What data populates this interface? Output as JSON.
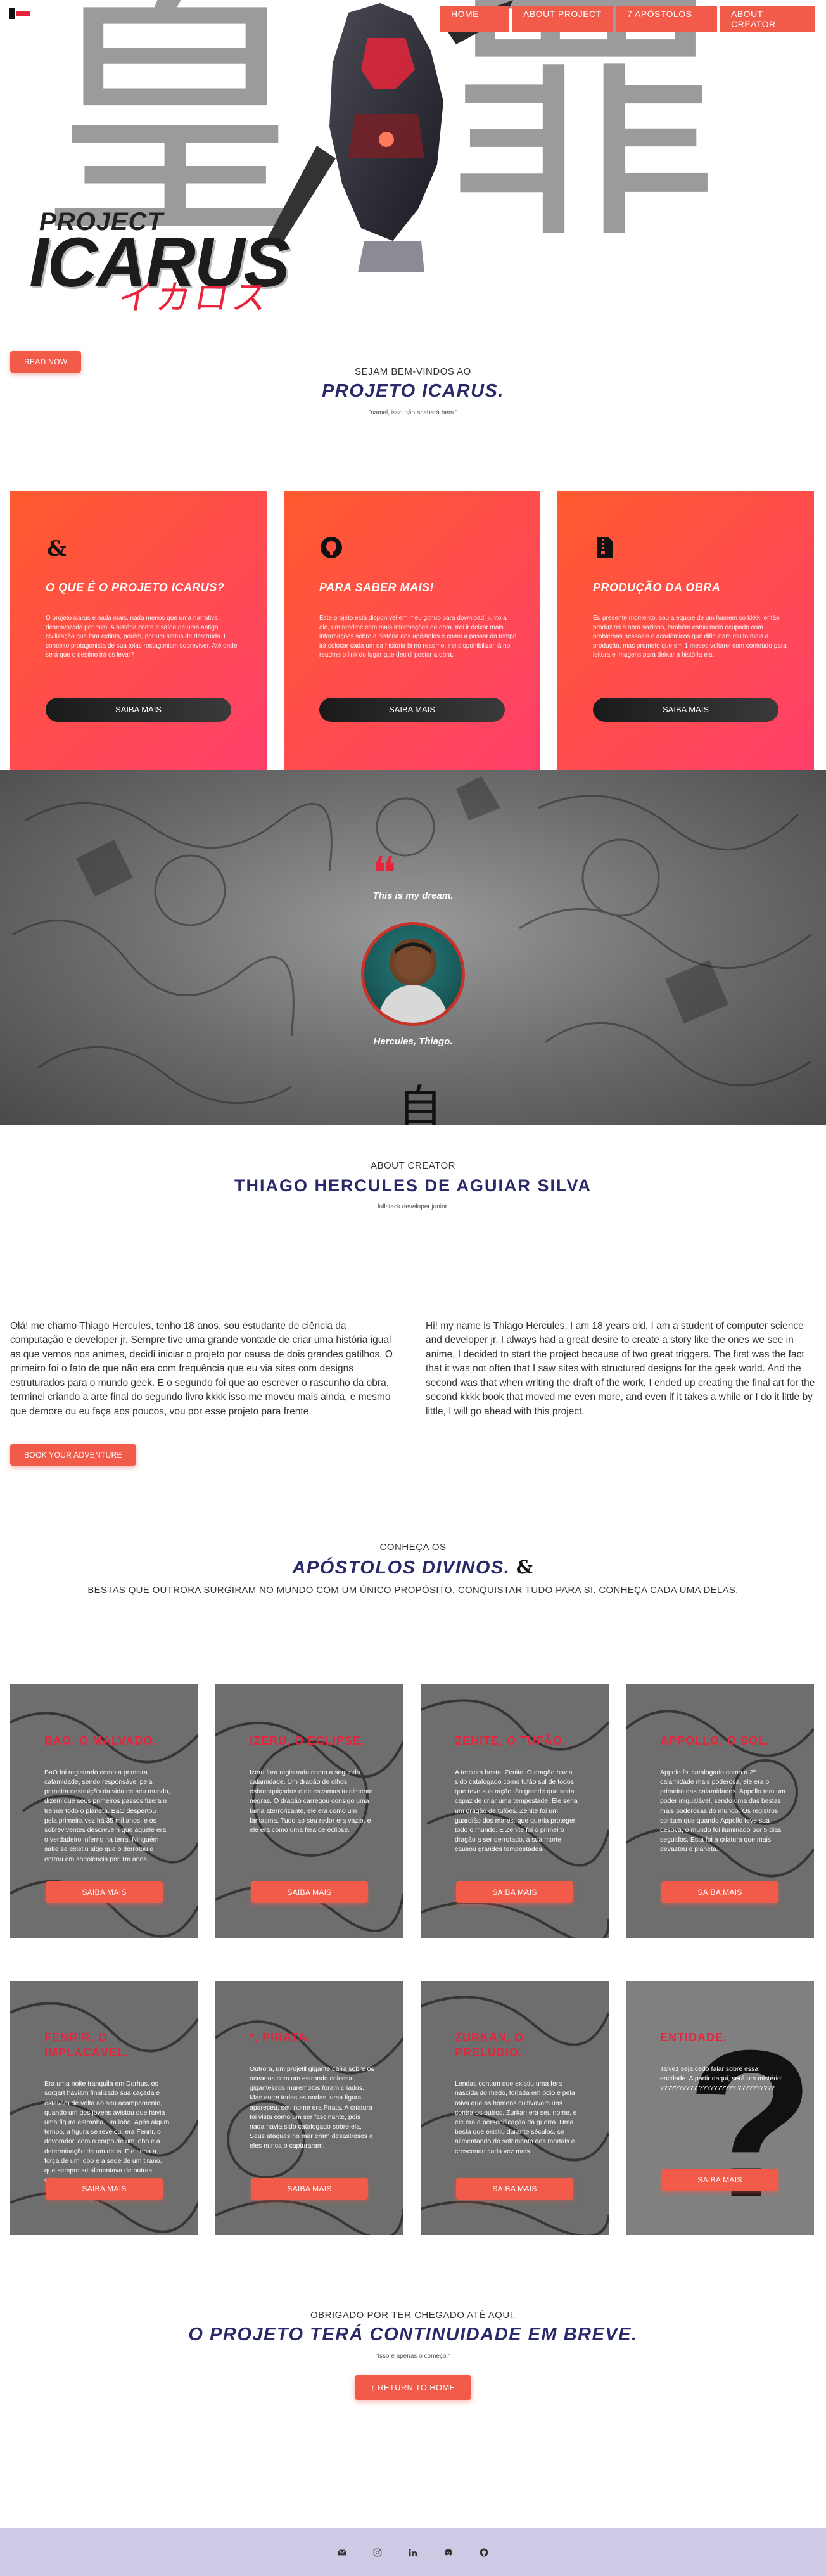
{
  "nav": {
    "items": [
      {
        "label": "HOME"
      },
      {
        "label": "ABOUT PROJECT"
      },
      {
        "label": "7 APÓSTOLOS"
      },
      {
        "label": "ABOUT CREATOR"
      }
    ]
  },
  "hero": {
    "logo_line1": "PROJECT",
    "logo_line2": "ICARUS",
    "logo_katakana": "イカロス",
    "kanji_background": "皇 罪"
  },
  "welcome": {
    "read_now_label": "READ NOW",
    "kicker": "SEJAM BEM-VINDOS AO",
    "title": "PROJETO ICARUS.",
    "note": "\"namel, isso não acabará bem.\""
  },
  "features": [
    {
      "icon": "dnd-icon",
      "title": "O QUE É O PROJETO ICARUS?",
      "text": "O projeto icarus é nada mais, nada menos que uma narrativa desenvolvida por mim. A história conta a saída de uma antiga civilização que fora extinta, porém, por um status de destruída. E conceito protagonista de sua tolas rostagonism sobreviver. Até onde será que o destino irá os levar?",
      "button": "SAIBA MAIS"
    },
    {
      "icon": "github-icon",
      "title": "PARA SABER MAIS!",
      "text": "Este projeto está disponível em meu github para download, junto a ele, um readme com mais informações da obra. Irei ir deixar mais informações sobre a história dos apóstolos e como a passar do tempo irá colocar cada um da história lá no readme, irei disponibilizar lá no readme o link do lugar que decidi postar a obra.",
      "button": "SAIBA MAIS"
    },
    {
      "icon": "file-zip-icon",
      "title": "PRODUÇÃO DA OBRA",
      "text": "Eu presente momento, sou a equipe de um homem só kkkk, então produzirei a obra sozinho, também estou meio ocupado com problemas pessoais e acadêmicos que dificultam muito mais a produção, mas prometo que em 1 meses voltarei com conteúdo para leitura e imagens para deixar a história ela.",
      "button": "SAIBA MAIS"
    }
  ],
  "dream": {
    "quote_mark": "❝",
    "text": "This is my dream.",
    "name": "Hercules, Thiago.",
    "kanji": "自"
  },
  "creator": {
    "kicker": "ABOUT CREATOR",
    "name": "THIAGO HERCULES DE AGUIAR SILVA",
    "role": "fullstack developer junior.",
    "bio_pt": "Olá! me chamo Thiago Hercules, tenho 18 anos, sou estudante de ciência da computação e developer jr. Sempre tive uma grande vontade de criar uma história igual as que vemos nos animes, decidi iniciar o projeto por causa de dois grandes gatilhos. O primeiro foi o fato de que não era com frequência que eu via sites com designs estruturados para o mundo geek. E o segundo foi que ao escrever o rascunho da obra, terminei criando a arte final do segundo livro kkkk isso me moveu mais ainda, e mesmo que demore ou eu faça aos poucos, vou por esse projeto para frente.",
    "bio_en": "Hi! my name is Thiago Hercules, I am 18 years old, I am a student of computer science and developer jr. I always had a great desire to create a story like the ones we see in anime, I decided to start the project because of two great triggers. The first was the fact that it was not often that I saw sites with structured designs for the geek world. And the second was that when writing the draft of the work, I ended up creating the final art for the second kkkk book that moved me even more, and even if it takes a while or I do it little by little, I will go ahead with this project.",
    "button": "BOOK YOUR ADVENTURE"
  },
  "apostles": {
    "kicker": "CONHEÇA OS",
    "title": "APÓSTOLOS DIVINOS.",
    "subtitle": "BESTAS QUE OUTRORA SURGIRAM NO MUNDO COM UM ÚNICO PROPÓSITO, CONQUISTAR TUDO PARA SI. CONHEÇA CADA UMA DELAS.",
    "cards": [
      {
        "title": "BAO, O MALVADO.",
        "text": "BaO foi registrado como a primeira calamidade, sendo responsável pela primeira destruição da vida de seu mundo, dizem que seus primeiros passos fizeram tremer todo o planeta. BaO despertou pela primeira vez há 35 mil anos, e os sobreviventes descrevem que aquele era o verdadeiro inferno na terra. Ninguém sabe se existiu algo que o derrotou e entrou em sonolência por 1m anos.",
        "button": "SAIBA MAIS"
      },
      {
        "title": "IZERU, O ECLIPSE.",
        "text": "Izeru fora registrado como a segunda calamidade. Um dragão de olhos esbranquiçados e de escamas totalmente negras. O dragão carregou consigo uma fama aterrorizante, ele era como um fantasma. Tudo ao seu redor era vazio, e ele era como uma fera de eclipse.",
        "button": "SAIBA MAIS"
      },
      {
        "title": "ZENITE, O TUFÃO.",
        "text": "A terceira besta, Zenite. O dragão havia sido catalogado como tufão sul de todos, que teve sua ração tão grande que seria capaz de criar uma tempestade. Ele seria um dragão de tufões. Zenite foi um guardião dos mares, que queria proteger todo o mundo. E Zenite foi o primeiro dragão a ser derrotado, a sua morte causou grandes tempestades.",
        "button": "SAIBA MAIS"
      },
      {
        "title": "APPOLLO, O SOL.",
        "text": "Appolo foi catalogado como a 2ª calamidade mais poderosa, ele era o primeiro das calamidades. Appollo tem um poder inigualável, sendo uma das bestas mais poderosas do mundo. Os registros contam que quando Appollo teve sua desova, o mundo foi iluminado por 5 dias seguidos. Esta foi a criatura que mais devastou o planeta.",
        "button": "SAIBA MAIS"
      },
      {
        "title": "FENRIR, O IMPLACÁVEL.",
        "text": "Era uma noite tranquila em Dorhus, os sorgart haviam finalizado sua caçada e estavam de volta ao seu acampamento, quando um dos jovens avistou que havia uma figura estranha, um lobo. Após algum tempo, a figura se revelou, era Fenrir, o devorador, com o corpo de um lobo e a determinação de um deus. Ele tinha a força de um lobo e a sede de um tirano, que sempre se alimentava de outras criaturas.",
        "button": "SAIBA MAIS"
      },
      {
        "title": "*, PIRATA.",
        "text": "Outrora, um projetil gigante caíra sobre os oceanos com um estrondo colossal, gigantescos maremotos foram criados. Mas entre todas as ondas, uma figura apareceu, seu nome era Pirata. A criatura foi vista como um ser fascinante, pois nada havia sido catalogado sobre ela. Seus ataques no mar eram desastrosos e eles nunca o capturaram.",
        "button": "SAIBA MAIS"
      },
      {
        "title": "ZURKAN, O PRELÚDIO.",
        "text": "Lendas contam que existiu uma fera nascida do medo, forjada em ódio e pela raiva que os homens cultivavam uns contra os outros. Zurkan era seu nome, e ele era a personificação da guerra. Uma besta que existiu durante séculos, se alimentando do sofrimento dos mortais e crescendo cada vez mais.",
        "button": "SAIBA MAIS"
      },
      {
        "title": "ENTIDADE.",
        "text": "Talvez seja cedo falar sobre essa entidade. A partir daqui, será um mistério! ?????????? ?????????? ??????????",
        "button": "SAIBA MAIS"
      }
    ]
  },
  "closing": {
    "kicker": "OBRIGADO POR TER CHEGADO ATÉ AQUI.",
    "title": "O PROJETO TERÁ CONTINUIDADE EM BREVE.",
    "note": "\"isso é apenas o começo.\"",
    "button": "RETURN TO HOME"
  },
  "footer": {
    "icons": [
      "mail-icon",
      "instagram-icon",
      "linkedin-icon",
      "discord-icon",
      "github-icon"
    ],
    "background": "#cfc9e6"
  },
  "colors": {
    "accent": "#f25a4a",
    "card_gradient_start": "#ff5b2e",
    "card_gradient_end": "#ff3f6b",
    "title_navy": "#2a2a6a",
    "apostle_title": "#e8243c"
  }
}
